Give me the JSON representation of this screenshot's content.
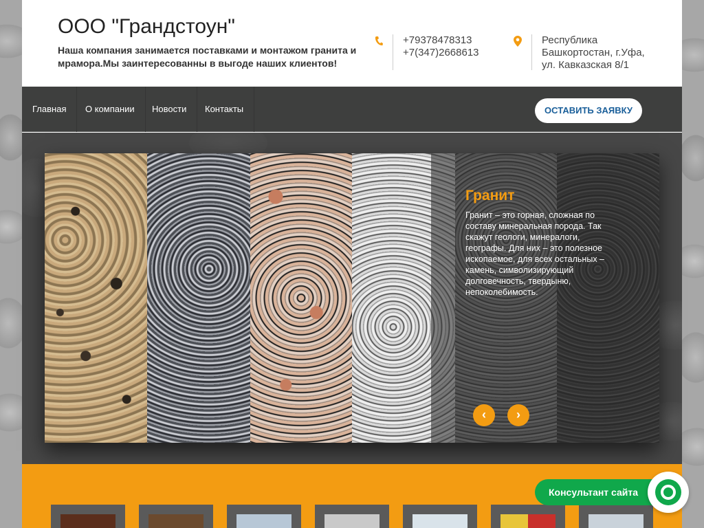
{
  "header": {
    "company_name": "ООО \"Грандстоун\"",
    "tagline": "Наша компания занимается поставками и монтажом гранита и мрамора.Мы заинтересованны в выгоде наших клиентов!",
    "phones": [
      "+79378478313",
      "+7(347)2668613"
    ],
    "address": [
      "Республика",
      "Башкортостан, г.Уфа,",
      "ул. Кавказская 8/1"
    ],
    "icons": {
      "phone": "phone-icon",
      "location": "map-pin-icon"
    }
  },
  "nav": {
    "items": [
      {
        "label": "Главная"
      },
      {
        "label": "О компании"
      },
      {
        "label": "Новости"
      },
      {
        "label": "Контакты"
      }
    ],
    "cta_label": "ОСТАВИТЬ ЗАЯВКУ"
  },
  "slider": {
    "title": "Гранит",
    "text": "Гранит – это горная, сложная по составу минеральная порода. Так скажут геологи, минералоги, географы. Для них – это полезное ископаемое, для всех остальных – камень, символизирующий долговечность, твердыню, непоколебимость.",
    "prev_icon": "‹",
    "next_icon": "›"
  },
  "consultant": {
    "label": "Консультант сайта",
    "icon": "chat-ring-icon"
  },
  "colors": {
    "accent": "#f39c12",
    "nav_bg": "#3e3f3e",
    "cta_text": "#1a5f9a",
    "consultant": "#10a84b"
  }
}
